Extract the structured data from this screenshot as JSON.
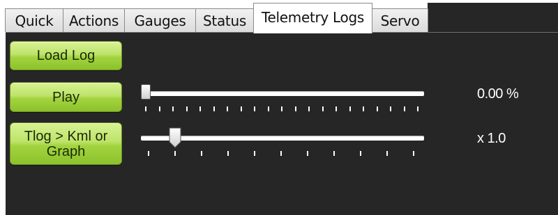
{
  "tabs": [
    {
      "label": "Quick"
    },
    {
      "label": "Actions"
    },
    {
      "label": "Gauges"
    },
    {
      "label": "Status"
    },
    {
      "label": "Telemetry Logs",
      "active": true
    },
    {
      "label": "Servo"
    }
  ],
  "buttons": {
    "load_log": "Load Log",
    "play": "Play",
    "tlog_to_kml": "Tlog > Kml or\nGraph"
  },
  "playback": {
    "position_percent": 0.0,
    "position_text": "0.00 %"
  },
  "speed": {
    "value": 1.0,
    "text": "x 1.0"
  },
  "colors": {
    "panel": "#262626",
    "button_green": "#a3d440"
  }
}
